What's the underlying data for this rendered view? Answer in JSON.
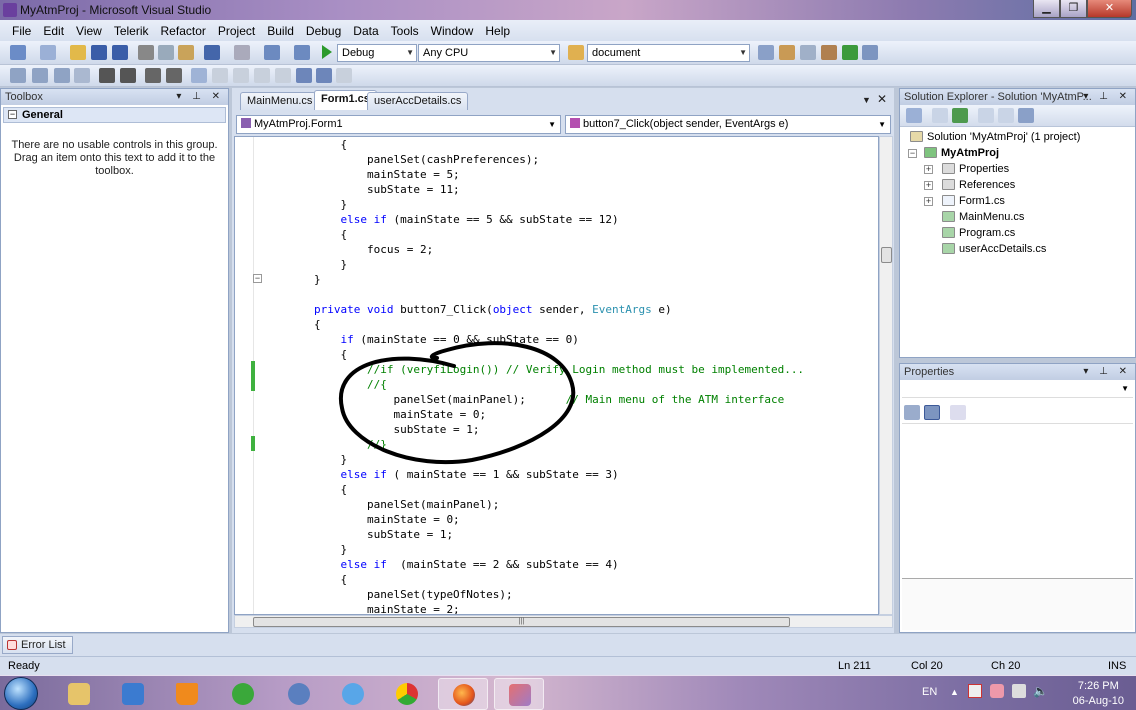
{
  "window": {
    "title": "MyAtmProj - Microsoft Visual Studio",
    "min_glyph": "▁",
    "max_glyph": "❐",
    "close_glyph": "✕"
  },
  "menu": [
    "File",
    "Edit",
    "View",
    "Telerik",
    "Refactor",
    "Project",
    "Build",
    "Debug",
    "Data",
    "Tools",
    "Window",
    "Help"
  ],
  "toolbar": {
    "config": "Debug",
    "platform": "Any CPU",
    "find_value": "document"
  },
  "toolbox": {
    "title": "Toolbox",
    "group": "General",
    "message": "There are no usable controls in this group. Drag an item onto this text to add it to the toolbox."
  },
  "editor": {
    "tabs": [
      "MainMenu.cs",
      "Form1.cs",
      "userAccDetails.cs"
    ],
    "active_tab": "Form1.cs",
    "class_nav": "MyAtmProj.Form1",
    "member_nav": "button7_Click(object sender, EventArgs e)",
    "scroll_glyph": "|||"
  },
  "code_lines": [
    {
      "indent": "            ",
      "parts": [
        {
          "t": "{",
          "c": ""
        }
      ]
    },
    {
      "indent": "                ",
      "parts": [
        {
          "t": "panelSet(cashPreferences);",
          "c": ""
        }
      ]
    },
    {
      "indent": "                ",
      "parts": [
        {
          "t": "mainState = 5;",
          "c": ""
        }
      ]
    },
    {
      "indent": "                ",
      "parts": [
        {
          "t": "subState = 11;",
          "c": ""
        }
      ]
    },
    {
      "indent": "            ",
      "parts": [
        {
          "t": "}",
          "c": ""
        }
      ]
    },
    {
      "indent": "            ",
      "parts": [
        {
          "t": "else if",
          "c": "kw"
        },
        {
          "t": " (mainState == 5 && subState == 12)",
          "c": ""
        }
      ]
    },
    {
      "indent": "            ",
      "parts": [
        {
          "t": "{",
          "c": ""
        }
      ]
    },
    {
      "indent": "                ",
      "parts": [
        {
          "t": "focus = 2;",
          "c": ""
        }
      ]
    },
    {
      "indent": "            ",
      "parts": [
        {
          "t": "}",
          "c": ""
        }
      ]
    },
    {
      "indent": "        ",
      "parts": [
        {
          "t": "}",
          "c": ""
        }
      ]
    },
    {
      "indent": "",
      "parts": [
        {
          "t": "",
          "c": ""
        }
      ]
    },
    {
      "indent": "        ",
      "parts": [
        {
          "t": "private void",
          "c": "kw"
        },
        {
          "t": " button7_Click(",
          "c": ""
        },
        {
          "t": "object",
          "c": "kw"
        },
        {
          "t": " sender, ",
          "c": ""
        },
        {
          "t": "EventArgs",
          "c": "ty"
        },
        {
          "t": " e)",
          "c": ""
        }
      ]
    },
    {
      "indent": "        ",
      "parts": [
        {
          "t": "{",
          "c": ""
        }
      ]
    },
    {
      "indent": "            ",
      "parts": [
        {
          "t": "if",
          "c": "kw"
        },
        {
          "t": " (mainState == 0 && subState == 0)",
          "c": ""
        }
      ]
    },
    {
      "indent": "            ",
      "parts": [
        {
          "t": "{",
          "c": ""
        }
      ]
    },
    {
      "indent": "                ",
      "parts": [
        {
          "t": "//if (veryfiLogin()) // Verify Login method must be implemented...",
          "c": "cm"
        }
      ]
    },
    {
      "indent": "                ",
      "parts": [
        {
          "t": "//{",
          "c": "cm"
        }
      ]
    },
    {
      "indent": "                    ",
      "parts": [
        {
          "t": "panelSet(mainPanel);      ",
          "c": ""
        },
        {
          "t": "// Main menu of the ATM interface",
          "c": "cm"
        }
      ]
    },
    {
      "indent": "                    ",
      "parts": [
        {
          "t": "mainState = 0;",
          "c": ""
        }
      ]
    },
    {
      "indent": "                    ",
      "parts": [
        {
          "t": "subState = 1;",
          "c": ""
        }
      ]
    },
    {
      "indent": "                ",
      "parts": [
        {
          "t": "//}",
          "c": "cm"
        }
      ]
    },
    {
      "indent": "            ",
      "parts": [
        {
          "t": "}",
          "c": ""
        }
      ]
    },
    {
      "indent": "            ",
      "parts": [
        {
          "t": "else if",
          "c": "kw"
        },
        {
          "t": " ( mainState == 1 && subState == 3)",
          "c": ""
        }
      ]
    },
    {
      "indent": "            ",
      "parts": [
        {
          "t": "{",
          "c": ""
        }
      ]
    },
    {
      "indent": "                ",
      "parts": [
        {
          "t": "panelSet(mainPanel);",
          "c": ""
        }
      ]
    },
    {
      "indent": "                ",
      "parts": [
        {
          "t": "mainState = 0;",
          "c": ""
        }
      ]
    },
    {
      "indent": "                ",
      "parts": [
        {
          "t": "subState = 1;",
          "c": ""
        }
      ]
    },
    {
      "indent": "            ",
      "parts": [
        {
          "t": "}",
          "c": ""
        }
      ]
    },
    {
      "indent": "            ",
      "parts": [
        {
          "t": "else if",
          "c": "kw"
        },
        {
          "t": "  (mainState == 2 && subState == 4)",
          "c": ""
        }
      ]
    },
    {
      "indent": "            ",
      "parts": [
        {
          "t": "{",
          "c": ""
        }
      ]
    },
    {
      "indent": "                ",
      "parts": [
        {
          "t": "panelSet(typeOfNotes);",
          "c": ""
        }
      ]
    },
    {
      "indent": "                ",
      "parts": [
        {
          "t": "mainState = 2;",
          "c": ""
        }
      ]
    }
  ],
  "solution_explorer": {
    "title": "Solution Explorer - Solution 'MyAtmP...",
    "items": [
      {
        "label": "Solution 'MyAtmProj' (1 project)",
        "bold": false
      },
      {
        "label": "MyAtmProj",
        "bold": true
      },
      {
        "label": "Properties",
        "bold": false
      },
      {
        "label": "References",
        "bold": false
      },
      {
        "label": "Form1.cs",
        "bold": false
      },
      {
        "label": "MainMenu.cs",
        "bold": false
      },
      {
        "label": "Program.cs",
        "bold": false
      },
      {
        "label": "userAccDetails.cs",
        "bold": false
      }
    ]
  },
  "properties": {
    "title": "Properties"
  },
  "error_list": {
    "label": "Error List"
  },
  "status": {
    "ready": "Ready",
    "ln": "Ln 211",
    "col": "Col 20",
    "ch": "Ch 20",
    "ins": "INS"
  },
  "taskbar": {
    "lang": "EN",
    "time": "7:26 PM",
    "date": "06-Aug-10"
  },
  "colors": {
    "keyword": "#0000ff",
    "comment": "#008000",
    "type": "#2b91af",
    "change_bar": "#3fb13f"
  }
}
